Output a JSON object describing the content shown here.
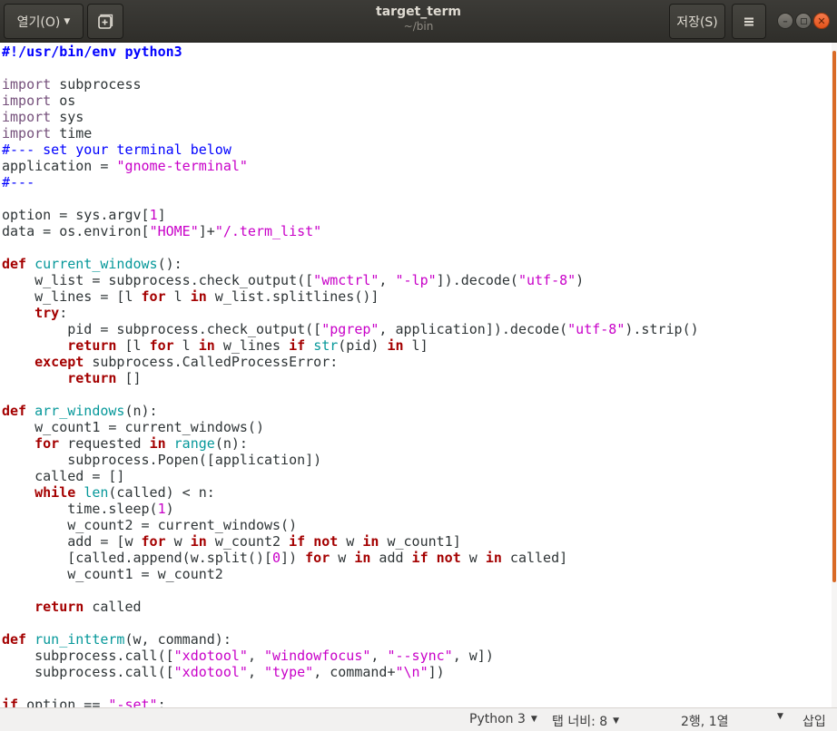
{
  "header": {
    "open_label": "열기(O)",
    "title": "target_term",
    "subtitle": "~/bin",
    "save_label": "저장(S)"
  },
  "colors": {
    "accent": "#d96a26",
    "keyword": "#a40000",
    "string": "#c800c8",
    "function_name": "#06989a",
    "comment": "#0000ff",
    "import": "#75507b"
  },
  "icons": {
    "open_dropdown": "chevron-down-icon",
    "new_tab": "new-document-icon",
    "menu": "hamburger-menu-icon",
    "minimize": "minimize-icon",
    "maximize": "maximize-icon",
    "close": "close-icon"
  },
  "editor": {
    "lines": [
      [
        [
          "sh",
          "#!/usr/bin/env python3"
        ]
      ],
      [],
      [
        [
          "imp",
          "import"
        ],
        [
          "n",
          " subprocess"
        ]
      ],
      [
        [
          "imp",
          "import"
        ],
        [
          "n",
          " os"
        ]
      ],
      [
        [
          "imp",
          "import"
        ],
        [
          "n",
          " sys"
        ]
      ],
      [
        [
          "imp",
          "import"
        ],
        [
          "n",
          " time"
        ]
      ],
      [
        [
          "cm",
          "#--- set your terminal below"
        ]
      ],
      [
        [
          "n",
          "application = "
        ],
        [
          "str",
          "\"gnome-terminal\""
        ]
      ],
      [
        [
          "cm",
          "#---"
        ]
      ],
      [],
      [
        [
          "n",
          "option = sys.argv["
        ],
        [
          "num",
          "1"
        ],
        [
          "n",
          "]"
        ]
      ],
      [
        [
          "n",
          "data = os.environ["
        ],
        [
          "str",
          "\"HOME\""
        ],
        [
          "n",
          "]+"
        ],
        [
          "str",
          "\"/.term_list\""
        ]
      ],
      [],
      [
        [
          "kw",
          "def"
        ],
        [
          "n",
          " "
        ],
        [
          "fn",
          "current_windows"
        ],
        [
          "n",
          "():"
        ]
      ],
      [
        [
          "n",
          "    w_list = subprocess.check_output(["
        ],
        [
          "str",
          "\"wmctrl\""
        ],
        [
          "n",
          ", "
        ],
        [
          "str",
          "\"-lp\""
        ],
        [
          "n",
          "]).decode("
        ],
        [
          "str",
          "\"utf-8\""
        ],
        [
          "n",
          ")"
        ]
      ],
      [
        [
          "n",
          "    w_lines = [l "
        ],
        [
          "kw",
          "for"
        ],
        [
          "n",
          " l "
        ],
        [
          "kw",
          "in"
        ],
        [
          "n",
          " w_list.splitlines()]"
        ]
      ],
      [
        [
          "n",
          "    "
        ],
        [
          "kw",
          "try"
        ],
        [
          "n",
          ":"
        ]
      ],
      [
        [
          "n",
          "        pid = subprocess.check_output(["
        ],
        [
          "str",
          "\"pgrep\""
        ],
        [
          "n",
          ", application]).decode("
        ],
        [
          "str",
          "\"utf-8\""
        ],
        [
          "n",
          ").strip()"
        ]
      ],
      [
        [
          "n",
          "        "
        ],
        [
          "kw",
          "return"
        ],
        [
          "n",
          " [l "
        ],
        [
          "kw",
          "for"
        ],
        [
          "n",
          " l "
        ],
        [
          "kw",
          "in"
        ],
        [
          "n",
          " w_lines "
        ],
        [
          "kw",
          "if"
        ],
        [
          "n",
          " "
        ],
        [
          "bi",
          "str"
        ],
        [
          "n",
          "(pid) "
        ],
        [
          "kw",
          "in"
        ],
        [
          "n",
          " l]"
        ]
      ],
      [
        [
          "n",
          "    "
        ],
        [
          "kw",
          "except"
        ],
        [
          "n",
          " subprocess.CalledProcessError:"
        ]
      ],
      [
        [
          "n",
          "        "
        ],
        [
          "kw",
          "return"
        ],
        [
          "n",
          " []"
        ]
      ],
      [],
      [
        [
          "kw",
          "def"
        ],
        [
          "n",
          " "
        ],
        [
          "fn",
          "arr_windows"
        ],
        [
          "n",
          "(n):"
        ]
      ],
      [
        [
          "n",
          "    w_count1 = current_windows()"
        ]
      ],
      [
        [
          "n",
          "    "
        ],
        [
          "kw",
          "for"
        ],
        [
          "n",
          " requested "
        ],
        [
          "kw",
          "in"
        ],
        [
          "n",
          " "
        ],
        [
          "bi",
          "range"
        ],
        [
          "n",
          "(n):"
        ]
      ],
      [
        [
          "n",
          "        subprocess.Popen([application])"
        ]
      ],
      [
        [
          "n",
          "    called = []"
        ]
      ],
      [
        [
          "n",
          "    "
        ],
        [
          "kw",
          "while"
        ],
        [
          "n",
          " "
        ],
        [
          "bi",
          "len"
        ],
        [
          "n",
          "(called) < n:"
        ]
      ],
      [
        [
          "n",
          "        time.sleep("
        ],
        [
          "num",
          "1"
        ],
        [
          "n",
          ")"
        ]
      ],
      [
        [
          "n",
          "        w_count2 = current_windows()"
        ]
      ],
      [
        [
          "n",
          "        add = [w "
        ],
        [
          "kw",
          "for"
        ],
        [
          "n",
          " w "
        ],
        [
          "kw",
          "in"
        ],
        [
          "n",
          " w_count2 "
        ],
        [
          "kw",
          "if"
        ],
        [
          "n",
          " "
        ],
        [
          "kw",
          "not"
        ],
        [
          "n",
          " w "
        ],
        [
          "kw",
          "in"
        ],
        [
          "n",
          " w_count1]"
        ]
      ],
      [
        [
          "n",
          "        [called.append(w.split()["
        ],
        [
          "num",
          "0"
        ],
        [
          "n",
          "]) "
        ],
        [
          "kw",
          "for"
        ],
        [
          "n",
          " w "
        ],
        [
          "kw",
          "in"
        ],
        [
          "n",
          " add "
        ],
        [
          "kw",
          "if"
        ],
        [
          "n",
          " "
        ],
        [
          "kw",
          "not"
        ],
        [
          "n",
          " w "
        ],
        [
          "kw",
          "in"
        ],
        [
          "n",
          " called]"
        ]
      ],
      [
        [
          "n",
          "        w_count1 = w_count2"
        ]
      ],
      [],
      [
        [
          "n",
          "    "
        ],
        [
          "kw",
          "return"
        ],
        [
          "n",
          " called"
        ]
      ],
      [],
      [
        [
          "kw",
          "def"
        ],
        [
          "n",
          " "
        ],
        [
          "fn",
          "run_intterm"
        ],
        [
          "n",
          "(w, command):"
        ]
      ],
      [
        [
          "n",
          "    subprocess.call(["
        ],
        [
          "str",
          "\"xdotool\""
        ],
        [
          "n",
          ", "
        ],
        [
          "str",
          "\"windowfocus\""
        ],
        [
          "n",
          ", "
        ],
        [
          "str",
          "\"--sync\""
        ],
        [
          "n",
          ", w])"
        ]
      ],
      [
        [
          "n",
          "    subprocess.call(["
        ],
        [
          "str",
          "\"xdotool\""
        ],
        [
          "n",
          ", "
        ],
        [
          "str",
          "\"type\""
        ],
        [
          "n",
          ", command+"
        ],
        [
          "str",
          "\"\\n\""
        ],
        [
          "n",
          "])"
        ]
      ],
      [],
      [
        [
          "kw",
          "if"
        ],
        [
          "n",
          " option == "
        ],
        [
          "str",
          "\"-set\""
        ],
        [
          "n",
          ":"
        ]
      ]
    ]
  },
  "statusbar": {
    "language": "Python 3",
    "tab_width": "탭 너비: 8",
    "cursor_position": "2행, 1열",
    "insert_mode": "삽입"
  }
}
